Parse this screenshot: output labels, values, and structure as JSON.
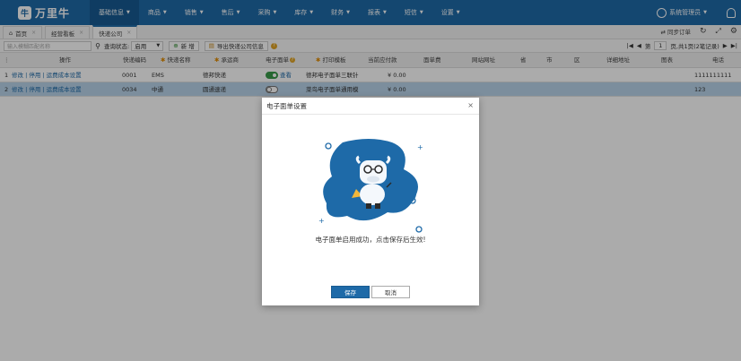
{
  "brand": {
    "name": "万里牛"
  },
  "nav": {
    "items": [
      {
        "label": "基础信息",
        "active": true
      },
      {
        "label": "商品"
      },
      {
        "label": "销售"
      },
      {
        "label": "售后"
      },
      {
        "label": "采购"
      },
      {
        "label": "库存"
      },
      {
        "label": "财务"
      },
      {
        "label": "报表"
      },
      {
        "label": "短信"
      },
      {
        "label": "设置"
      }
    ],
    "user": "系统管理员"
  },
  "tabs": [
    {
      "label": "首页"
    },
    {
      "label": "经营看板"
    },
    {
      "label": "快递公司",
      "active": true
    }
  ],
  "tabbar_right": {
    "sync": "同步订单"
  },
  "toolbar": {
    "search_placeholder": "输入模糊匹配名称",
    "filter_label": "查询状态:",
    "filter_value": "启用",
    "add_label": "新 增",
    "export_label": "导出快递公司信息",
    "page_label": "第",
    "page_value": "1",
    "page_suffix": "页,共1页(2笔记录)"
  },
  "table": {
    "headers": [
      "操作",
      "快递编码",
      "快递名称",
      "承运商",
      "电子面单",
      "打印模板",
      "当前应付款",
      "面单费",
      "网站网址",
      "省",
      "市",
      "区",
      "详细地址",
      "图表",
      "电话"
    ],
    "rows": [
      {
        "idx": "1",
        "action": "修改 | 停用 | 运费成本设置",
        "code": "0001",
        "name": "EMS",
        "carrier": "德邦快递",
        "esheet_on": true,
        "view": "查看",
        "template": "德邦电子面单三联针",
        "payable": "¥ 0.00",
        "phone": "1111111111"
      },
      {
        "idx": "2",
        "action": "修改 | 停用 | 运费成本设置",
        "code": "0034",
        "name": "中通",
        "carrier": "圆通速递",
        "esheet_on": false,
        "view": "",
        "template": "菜鸟电子面单通用模",
        "payable": "¥ 0.00",
        "phone": "123"
      }
    ]
  },
  "modal": {
    "title": "电子面单设置",
    "message": "电子面单启用成功，点击保存后生效!",
    "save": "保存",
    "cancel": "取消"
  },
  "colors": {
    "brand": "#1e6aa8",
    "toggle_on": "#3a9a4a"
  }
}
